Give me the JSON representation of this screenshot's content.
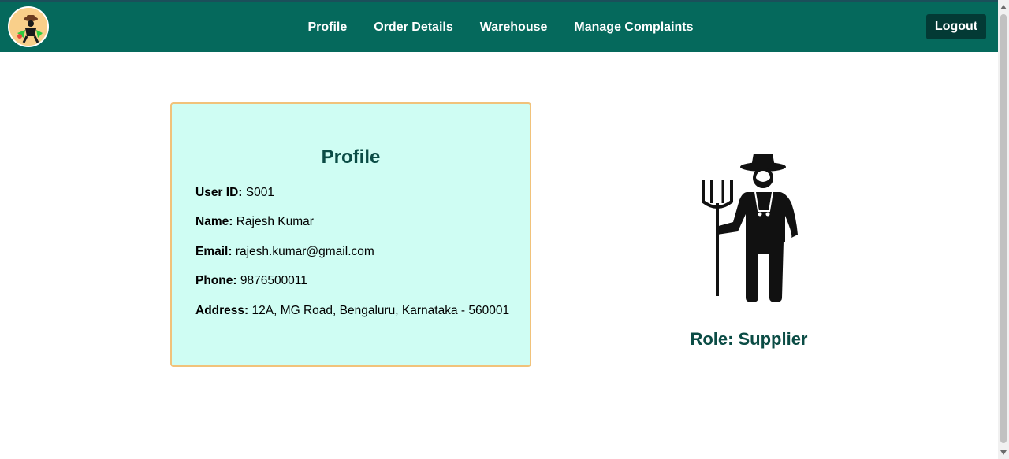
{
  "navbar": {
    "logo_icon": "farmer-logo-icon",
    "links": [
      "Profile",
      "Order Details",
      "Warehouse",
      "Manage Complaints"
    ],
    "logout_label": "Logout",
    "colors": {
      "background": "#05695c",
      "logout_bg": "#033a35"
    }
  },
  "profile": {
    "title": "Profile",
    "fields": [
      {
        "label": "User ID:",
        "value": "S001"
      },
      {
        "label": "Name:",
        "value": "Rajesh Kumar"
      },
      {
        "label": "Email:",
        "value": "rajesh.kumar@gmail.com"
      },
      {
        "label": "Phone:",
        "value": "9876500011"
      },
      {
        "label": "Address:",
        "value": "12A, MG Road, Bengaluru, Karnataka - 560001"
      }
    ],
    "colors": {
      "card_bg": "#cffdf3",
      "card_border": "#f1c27a",
      "title": "#0b4c45"
    }
  },
  "role": {
    "icon": "farmer-with-pitchfork-icon",
    "label": "Role:",
    "value": "Supplier"
  }
}
